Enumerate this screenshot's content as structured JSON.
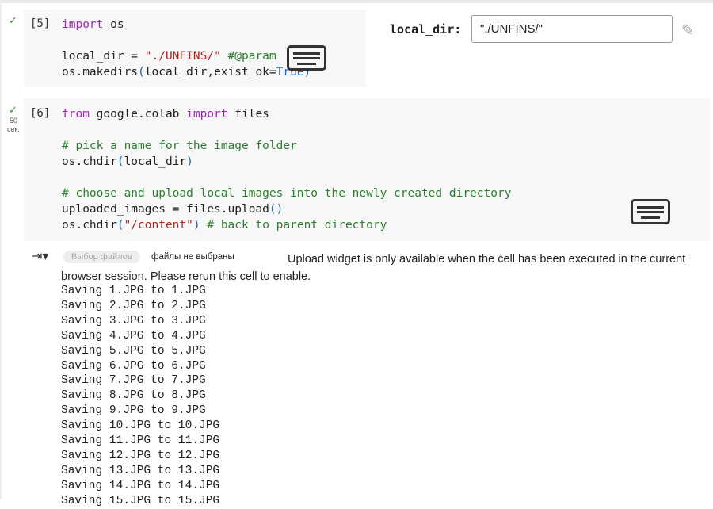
{
  "cell5": {
    "prompt": "[5]",
    "lines": [
      [
        "kw",
        "import"
      ],
      [
        "t",
        " os"
      ]
    ],
    "code": {
      "l1_kw": "import",
      "l1_rest": " os",
      "l3_a": "local_dir = ",
      "l3_str": "\"./UNFINS/\"",
      "l3_com": " #@param",
      "l4_a": "os.makedirs",
      "l4_p": "(",
      "l4_b": "local_dir,exist_ok=",
      "l4_c": "True)"
    },
    "form": {
      "label": "local_dir:",
      "value": "\"./UNFINS/\""
    }
  },
  "cell6": {
    "prompt": "[6]",
    "runtime": "50",
    "runtime_unit": "сек.",
    "code": {
      "l1_kw1": "from",
      "l1_mid": " google.colab ",
      "l1_kw2": "import",
      "l1_end": " files",
      "l3": "# pick a name for the image folder",
      "l4_a": "os.chdir",
      "l4_p1": "(",
      "l4_b": "local_dir",
      "l4_p2": ")",
      "l6": "# choose and upload local images into the newly created directory",
      "l7_a": "uploaded_images = files.upload",
      "l7_p": "()",
      "l8_a": "os.chdir",
      "l8_p1": "(",
      "l8_str": "\"/content\"",
      "l8_p2": ")",
      "l8_com": " # back to parent directory"
    }
  },
  "output": {
    "file_button": "Выбор файлов",
    "no_file": "файлы не выбраны",
    "message": "Upload widget is only available when the cell has been executed in the current browser session. Please rerun this cell to enable.",
    "lines": [
      "Saving 1.JPG to 1.JPG",
      "Saving 2.JPG to 2.JPG",
      "Saving 3.JPG to 3.JPG",
      "Saving 4.JPG to 4.JPG",
      "Saving 5.JPG to 5.JPG",
      "Saving 6.JPG to 6.JPG",
      "Saving 7.JPG to 7.JPG",
      "Saving 8.JPG to 8.JPG",
      "Saving 9.JPG to 9.JPG",
      "Saving 10.JPG to 10.JPG",
      "Saving 11.JPG to 11.JPG",
      "Saving 12.JPG to 12.JPG",
      "Saving 13.JPG to 13.JPG",
      "Saving 14.JPG to 14.JPG",
      "Saving 15.JPG to 15.JPG"
    ]
  }
}
